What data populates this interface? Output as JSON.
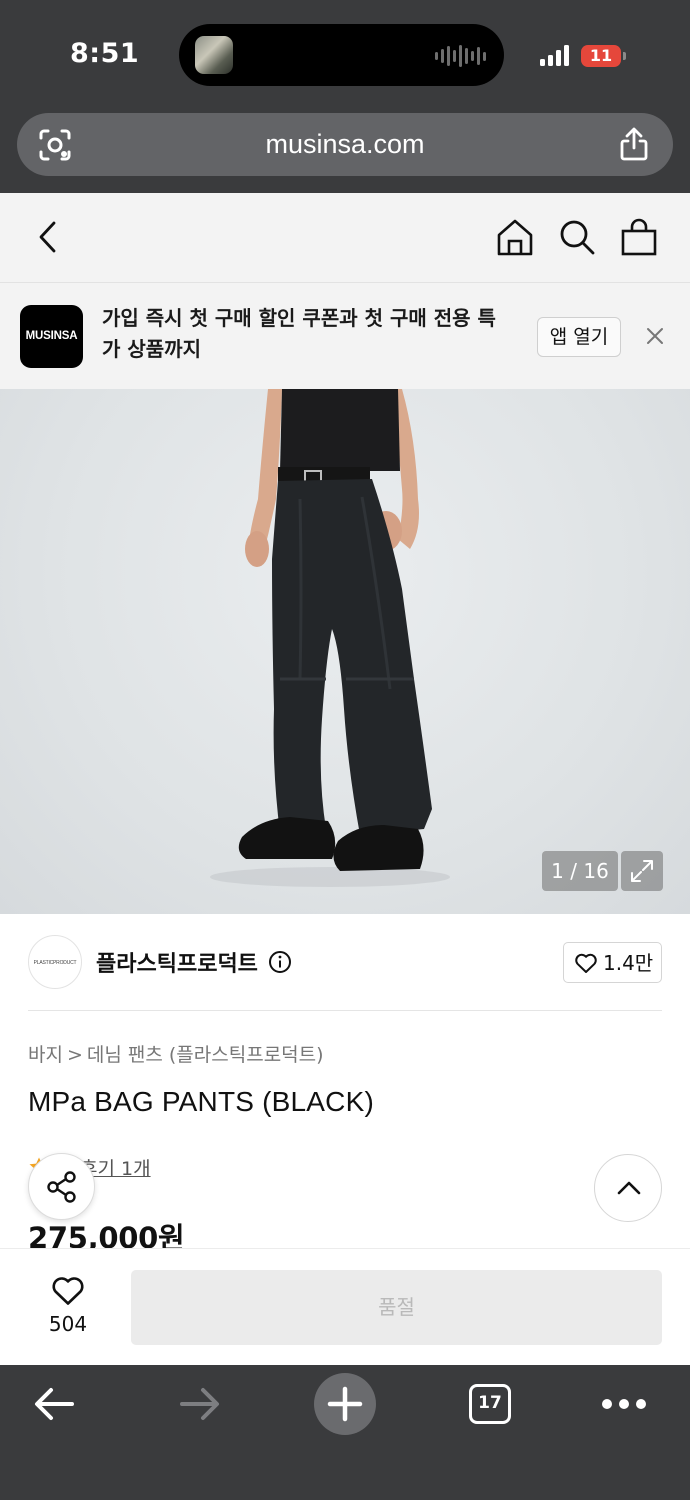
{
  "status_bar": {
    "time": "8:51",
    "battery": "11"
  },
  "browser": {
    "url": "musinsa.com",
    "tab_count": "17",
    "chrome_color": "#3a3b3d"
  },
  "app_banner": {
    "logo_text": "MUSINSA",
    "message": "가입 즉시 첫 구매 할인 쿠폰과 첫 구매 전용 특가 상품까지",
    "open_app_label": "앱 열기"
  },
  "gallery": {
    "counter": "1 / 16"
  },
  "brand": {
    "logo_text": "PLASTICPRODUCT",
    "name": "플라스틱프로덕트",
    "likes": "1.4만"
  },
  "breadcrumb": {
    "category": "바지",
    "separator": ">",
    "subcategory": "데님 팬츠 (플라스틱프로덕트)"
  },
  "product": {
    "title": "MPa BAG PANTS (BLACK)",
    "reviews": "후기 1개",
    "price": "275,000원"
  },
  "purchase_bar": {
    "wish_count": "504",
    "buy_label": "품절"
  },
  "colors": {
    "accent_star": "#f5a623",
    "soldout_bg": "#ebebeb",
    "soldout_text": "#b9b9b9"
  }
}
